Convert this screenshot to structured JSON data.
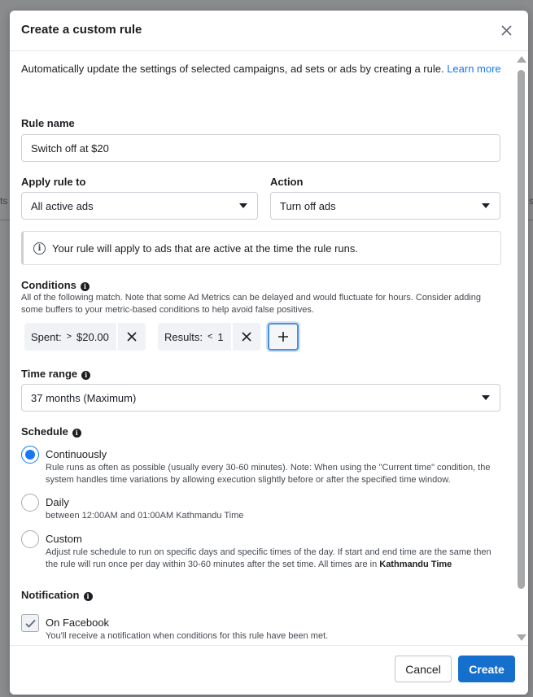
{
  "background": {
    "left_fragment": "ts",
    "right_fragment": "s"
  },
  "dialog": {
    "title": "Create a custom rule",
    "close_icon": "close-icon"
  },
  "intro": {
    "text": "Automatically update the settings of selected campaigns, ad sets or ads by creating a rule. ",
    "link_label": "Learn more"
  },
  "rule_name": {
    "label": "Rule name",
    "value": "Switch off at $20"
  },
  "apply_rule_to": {
    "label": "Apply rule to",
    "selected": "All active ads"
  },
  "action": {
    "label": "Action",
    "selected": "Turn off ads"
  },
  "notice": {
    "text": "Your rule will apply to ads that are active at the time the rule runs."
  },
  "conditions": {
    "label": "Conditions",
    "description": "All of the following match. Note that some Ad Metrics can be delayed and would fluctuate for hours. Consider adding some buffers to your metric-based conditions to help avoid false positives.",
    "items": [
      {
        "metric": "Spent:",
        "operator": ">",
        "value": "$20.00"
      },
      {
        "metric": "Results:",
        "operator": "<",
        "value": "1"
      }
    ],
    "add_icon": "plus-icon"
  },
  "time_range": {
    "label": "Time range",
    "selected": "37 months (Maximum)"
  },
  "schedule": {
    "label": "Schedule",
    "options": [
      {
        "title": "Continuously",
        "description": "Rule runs as often as possible (usually every 30-60 minutes). Note: When using the \"Current time\" condition, the system handles time variations by allowing execution slightly before or after the specified time window.",
        "checked": true
      },
      {
        "title": "Daily",
        "description": "between 12:00AM and 01:00AM Kathmandu Time",
        "checked": false
      },
      {
        "title": "Custom",
        "description": "Adjust rule schedule to run on specific days and specific times of the day. If start and end time are the same then the rule will run once per day within 30-60 minutes after the set time. All times are in ",
        "description_bold": "Kathmandu Time",
        "checked": false
      }
    ]
  },
  "notification": {
    "label": "Notification",
    "option_title": "On Facebook",
    "option_description": "You'll receive a notification when conditions for this rule have been met.",
    "checked": true
  },
  "footer": {
    "cancel_label": "Cancel",
    "create_label": "Create"
  },
  "colors": {
    "accent": "#1877f2",
    "primary_button": "#1470cc"
  }
}
